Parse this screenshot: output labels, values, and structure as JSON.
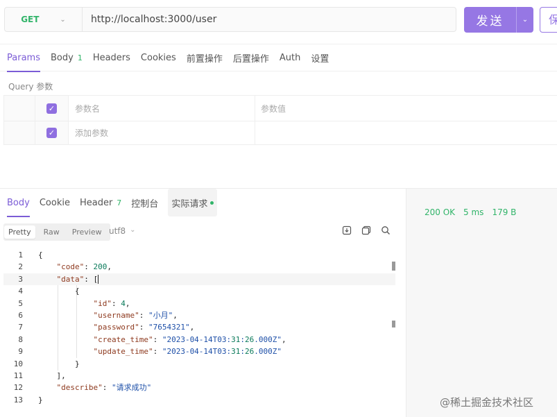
{
  "request": {
    "method": "GET",
    "url": "http://localhost:3000/user",
    "send_label": "发送",
    "save_label": "保"
  },
  "req_tabs": [
    {
      "label": "Params",
      "active": true
    },
    {
      "label": "Body",
      "count": "1"
    },
    {
      "label": "Headers"
    },
    {
      "label": "Cookies"
    },
    {
      "label": "前置操作"
    },
    {
      "label": "后置操作"
    },
    {
      "label": "Auth"
    },
    {
      "label": "设置"
    }
  ],
  "params": {
    "section_title": "Query 参数",
    "header_name": "参数名",
    "header_value": "参数值",
    "add_placeholder": "添加参数"
  },
  "response": {
    "tabs": [
      {
        "label": "Body",
        "active": true
      },
      {
        "label": "Cookie"
      },
      {
        "label": "Header",
        "count": "7"
      },
      {
        "label": "控制台"
      },
      {
        "label": "实际请求"
      }
    ],
    "status": "200 OK",
    "time": "5 ms",
    "size": "179 B",
    "formats": [
      "Pretty",
      "Raw",
      "Preview"
    ],
    "encoding": "utf8",
    "code_lines": [
      "{",
      "    \"code\": 200,",
      "    \"data\": [",
      "        {",
      "            \"id\": 4,",
      "            \"username\": \"小月\",",
      "            \"password\": \"7654321\",",
      "            \"create_time\": \"2023-04-14T03:31:26.000Z\",",
      "            \"update_time\": \"2023-04-14T03:31:26.000Z\"",
      "        }",
      "    ],",
      "    \"describe\": \"请求成功\"",
      "}"
    ]
  },
  "watermark": "@稀土掘金技术社区",
  "colors": {
    "accent": "#9677e4",
    "success": "#31b469"
  }
}
